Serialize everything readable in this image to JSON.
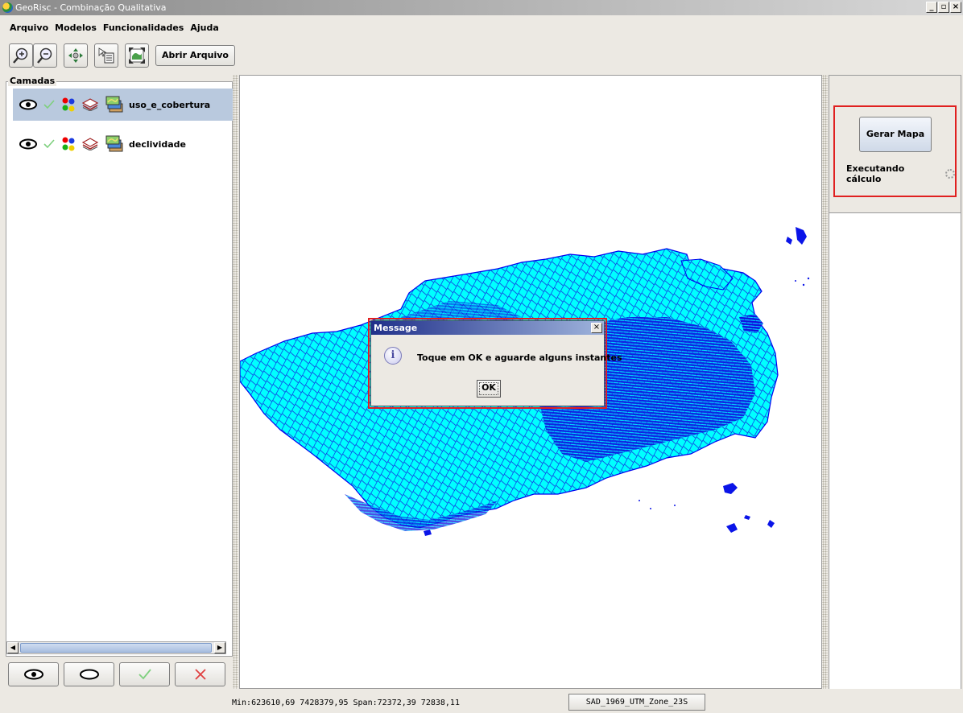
{
  "window": {
    "title": "GeoRisc - Combinação Qualitativa",
    "controls": [
      "_",
      "▫",
      "×"
    ]
  },
  "menu": {
    "items": [
      "Arquivo",
      "Modelos",
      "Funcionalidades",
      "Ajuda"
    ]
  },
  "toolbar": {
    "icons": [
      "zoom-in-icon",
      "zoom-out-icon",
      "pan-icon",
      "info-select-icon",
      "zoom-extent-icon"
    ],
    "open_file_label": "Abrir Arquivo"
  },
  "layers_panel": {
    "title": "Camadas",
    "layers": [
      {
        "name": "uso_e_cobertura",
        "selected": true
      },
      {
        "name": "declividade",
        "selected": false
      }
    ]
  },
  "bottom_buttons": [
    "show-all-icon",
    "hide-all-icon",
    "check-icon",
    "remove-icon"
  ],
  "right_panel": {
    "generate_label": "Gerar Mapa",
    "status_text": "Executando cálculo"
  },
  "dialog": {
    "title": "Message",
    "message": "Toque em OK e aguarde alguns instantes",
    "ok_label": "OK",
    "close_label": "×"
  },
  "status_bar": {
    "coords": "Min:623610,69 7428379,95 Span:72372,39 72838,11",
    "crs": "SAD_1969_UTM_Zone_23S"
  },
  "colors": {
    "map_fill": "#00ffff",
    "map_stroke": "#0000ee",
    "highlight": "#e02020",
    "selected_row": "#b9c9de"
  }
}
